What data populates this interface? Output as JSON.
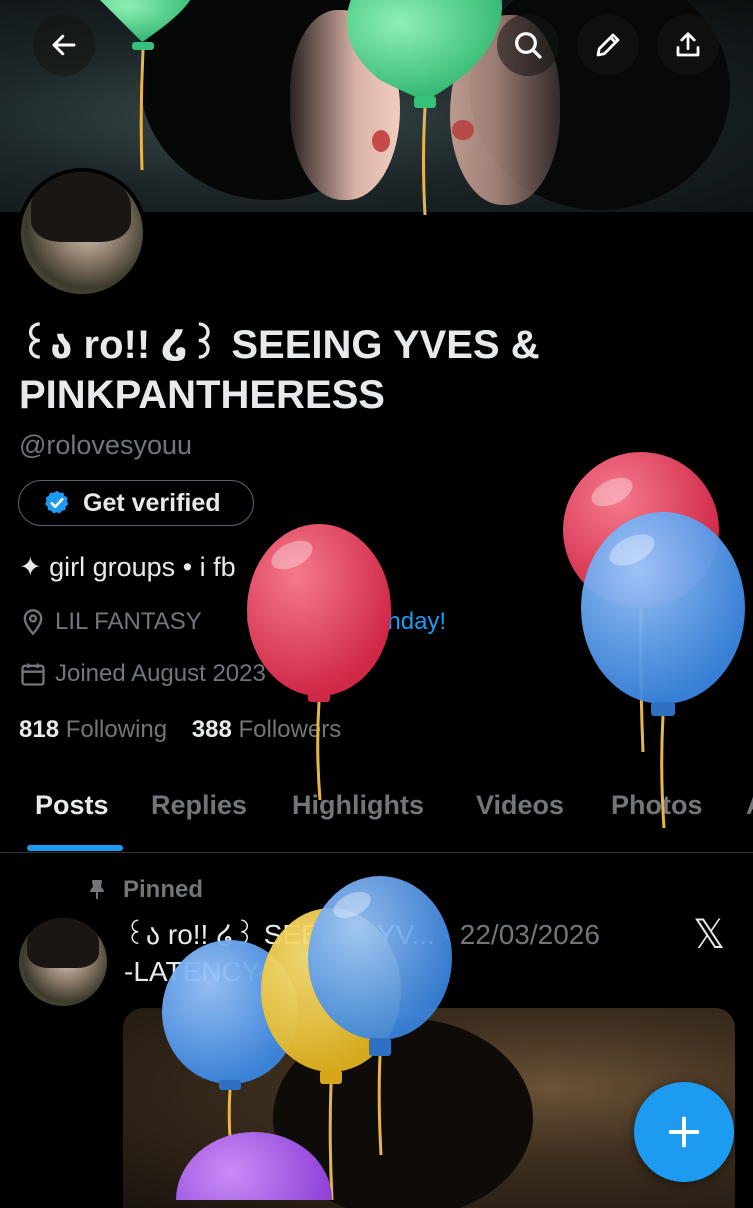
{
  "header": {
    "back_icon": "arrow-left-icon",
    "search_icon": "search-icon",
    "edit_icon": "pencil-icon",
    "share_icon": "share-icon",
    "feather_icon": "feather-icon"
  },
  "profile": {
    "display_name": "꒰ა ro!! ໒꒱ SEEING YVES & PINKPANTHERESS",
    "handle": "@rolovesyouu",
    "verify_label": "Get verified",
    "bio": "✦ girl groups • i fb",
    "location": "LIL FANTASY",
    "birthday_link": "Happy birthday!",
    "joined": "Joined August 2023",
    "joined_chevron": ">",
    "following_count": "818",
    "following_label": "Following",
    "followers_count": "388",
    "followers_label": "Followers"
  },
  "tabs": [
    {
      "label": "Posts"
    },
    {
      "label": "Replies"
    },
    {
      "label": "Highlights"
    },
    {
      "label": "Videos"
    },
    {
      "label": "Photos"
    },
    {
      "label": "A"
    }
  ],
  "post": {
    "pinned_label": "Pinned",
    "author": "꒰ა ro!! ໒꒱ SEEING YV...",
    "date": "· 22/03/2026",
    "text": "-LATENCY-",
    "x_logo": "𝕏"
  },
  "fab": {
    "icon": "plus-icon"
  },
  "colors": {
    "accent": "#1d9bf0",
    "muted": "#71767b",
    "text": "#e7e9ea",
    "background": "#000000"
  }
}
